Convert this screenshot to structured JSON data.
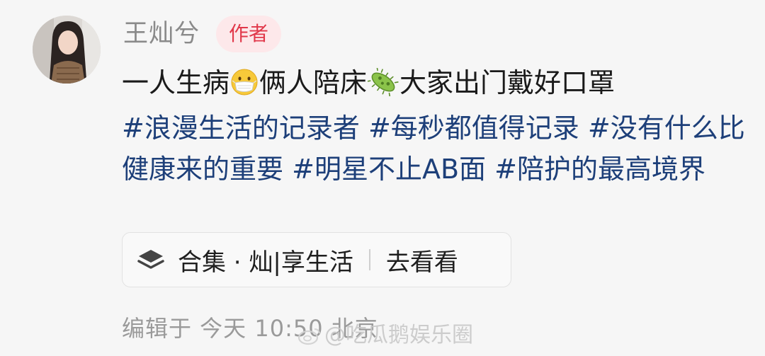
{
  "user": {
    "name": "王灿兮",
    "badge": "作者"
  },
  "post": {
    "line1_a": "一人生病",
    "emoji1": "mask-face-emoji",
    "line1_b": "俩人陪床",
    "emoji2": "microbe-emoji",
    "line1_c": "大家出门戴好口罩",
    "tags": [
      "#浪漫生活的记录者",
      "#每秒都值得记录",
      "#没有什么比健康来的重要",
      "#明星不止AB面",
      "#陪护的最高境界"
    ]
  },
  "collection": {
    "icon": "layers-icon",
    "label": "合集 · 灿|享生活",
    "action": "去看看"
  },
  "meta": {
    "edited_time": "编辑于 今天 10:50 北京"
  },
  "watermark": {
    "text": "@吃瓜鹅娱乐圈"
  },
  "colors": {
    "tag": "#1d3f79",
    "badge_text": "#e1384a",
    "badge_bg": "#fde8ea",
    "meta": "#9a9a9a"
  }
}
